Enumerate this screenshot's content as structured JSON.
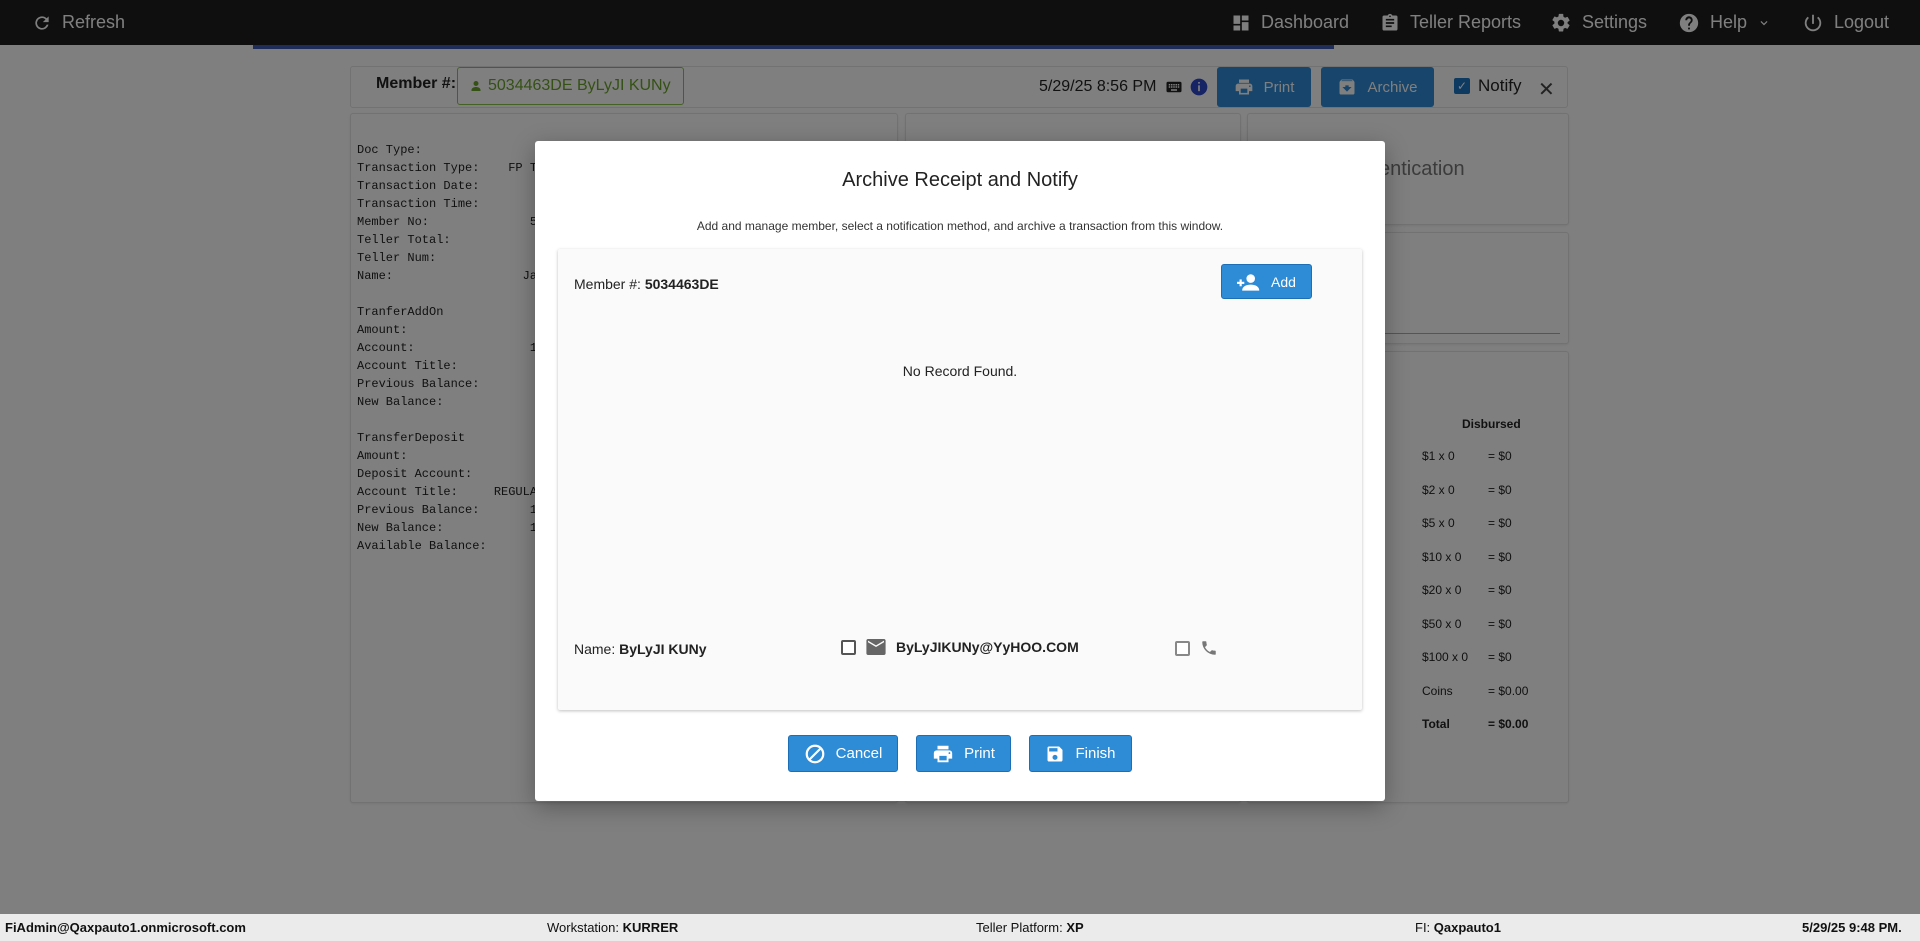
{
  "topbar": {
    "refresh": "Refresh",
    "dashboard": "Dashboard",
    "teller_reports": "Teller Reports",
    "settings": "Settings",
    "help": "Help",
    "logout": "Logout"
  },
  "member_bar": {
    "label": "Member #:",
    "member_chip": "5034463DE ByLyJI KUNy",
    "datetime": "5/29/25 8:56 PM",
    "print": "Print",
    "archive": "Archive",
    "notify": "Notify"
  },
  "receipt_lines": [
    "Doc Type:",
    "Transaction Type:    FP TRA",
    "Transaction Date:",
    "Transaction Time:",
    "Member No:              5",
    "Teller Total:",
    "Teller Num:",
    "Name:                  Ja",
    "",
    "TranferAddOn",
    "Amount:",
    "Account:                1",
    "Account Title:",
    "Previous Balance:",
    "New Balance:",
    "",
    "TransferDeposit",
    "Amount:",
    "Deposit Account:",
    "Account Title:     REGULAR",
    "Previous Balance:       1",
    "New Balance:            1",
    "Available Balance:"
  ],
  "auth_panel": {
    "text": "entication"
  },
  "disbursed": {
    "heading": "Disbursed",
    "rows": [
      {
        "label": "$1 x 0",
        "value": "= $0"
      },
      {
        "label": "$2 x 0",
        "value": "= $0"
      },
      {
        "label": "$5 x 0",
        "value": "= $0"
      },
      {
        "label": "$10 x 0",
        "value": "= $0"
      },
      {
        "label": "$20 x 0",
        "value": "= $0"
      },
      {
        "label": "$50 x 0",
        "value": "= $0"
      },
      {
        "label": "$100 x 0",
        "value": "= $0"
      },
      {
        "label": "Coins",
        "value": "= $0.00"
      },
      {
        "label": "Total",
        "value": "= $0.00"
      }
    ]
  },
  "modal": {
    "title": "Archive Receipt and Notify",
    "subtitle": "Add and manage member, select a notification method, and archive a transaction from this window.",
    "member_label": "Member #:",
    "member_number": "5034463DE",
    "add_button": "Add",
    "no_record": "No Record Found.",
    "name_label": "Name:",
    "name_value": "ByLyJI KUNy",
    "email": "ByLyJIKUNy@YyHOO.COM",
    "cancel": "Cancel",
    "print": "Print",
    "finish": "Finish"
  },
  "statusbar": {
    "user": "FiAdmin@Qaxpauto1.onmicrosoft.com",
    "workstation_label": "Workstation:",
    "workstation": "KURRER",
    "platform_label": "Teller Platform:",
    "platform": "XP",
    "fi_label": "FI:",
    "fi": "Qaxpauto1",
    "datetime": "5/29/25 9:48 PM."
  },
  "colors": {
    "topbar": "#1e1e1e",
    "accent": "#2e8bd6",
    "member_chip": "#6aa32a",
    "overlay": "rgba(0,0,0,0.5)"
  }
}
